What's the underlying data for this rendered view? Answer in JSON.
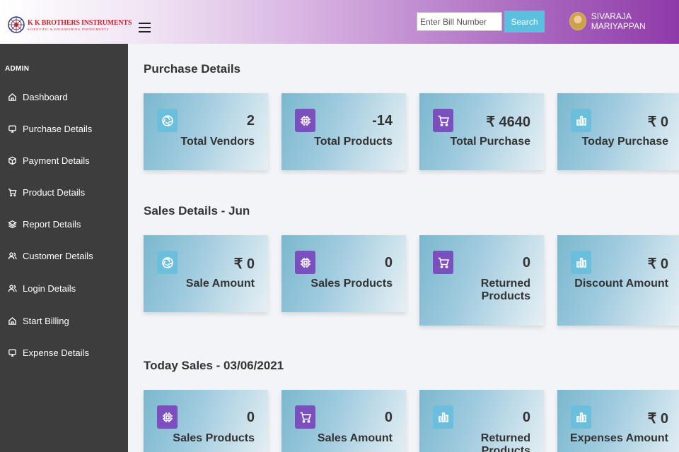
{
  "header": {
    "logo_title": "K K BROTHERS INSTRUMENTS",
    "logo_subtitle": "SCIENTIFIC & ENGINEERING INSTRUMENTS",
    "search_placeholder": "Enter Bill Number",
    "search_label": "Search",
    "user_name": "SIVARAJA MARIYAPPAN"
  },
  "sidebar": {
    "heading": "ADMIN",
    "items": [
      {
        "label": "Dashboard",
        "icon": "home-icon"
      },
      {
        "label": "Purchase Details",
        "icon": "monitor-icon"
      },
      {
        "label": "Payment Details",
        "icon": "box-icon"
      },
      {
        "label": "Product Details",
        "icon": "cart-icon"
      },
      {
        "label": "Report Details",
        "icon": "layers-icon"
      },
      {
        "label": "Customer Details",
        "icon": "users-icon"
      },
      {
        "label": "Login Details",
        "icon": "users-icon"
      },
      {
        "label": "Start Billing",
        "icon": "home-icon"
      },
      {
        "label": "Expense Details",
        "icon": "monitor-icon"
      }
    ]
  },
  "sections": {
    "purchase": {
      "title": "Purchase Details",
      "cards": [
        {
          "value": "2",
          "label": "Total Vendors",
          "icon": "aperture-icon"
        },
        {
          "value": "-14",
          "label": "Total Products",
          "icon": "chip-icon"
        },
        {
          "value": "₹ 4640",
          "label": "Total Purchase",
          "icon": "cart-icon"
        },
        {
          "value": "₹ 0",
          "label": "Today Purchase",
          "icon": "bar-chart-icon"
        }
      ]
    },
    "sales": {
      "title": "Sales Details - Jun",
      "cards": [
        {
          "value": "₹ 0",
          "label": "Sale Amount",
          "icon": "aperture-icon"
        },
        {
          "value": "0",
          "label": "Sales Products",
          "icon": "chip-icon"
        },
        {
          "value": "0",
          "label": "Returned Products",
          "icon": "cart-icon"
        },
        {
          "value": "₹ 0",
          "label": "Discount Amount",
          "icon": "bar-chart-icon"
        }
      ]
    },
    "today": {
      "title": "Today Sales - 03/06/2021",
      "cards": [
        {
          "value": "0",
          "label": "Sales Products",
          "icon": "chip-icon"
        },
        {
          "value": "0",
          "label": "Sales Amount",
          "icon": "cart-icon"
        },
        {
          "value": "0",
          "label": "Returned Products",
          "icon": "bar-chart-icon"
        },
        {
          "value": "₹ 0",
          "label": "Expenses Amount",
          "icon": "bar-chart-icon"
        }
      ]
    }
  },
  "colors": {
    "sidebar_bg": "#3d3d3d",
    "search_button": "#5bc0de",
    "icon_blue": "#6bbfdc",
    "icon_purple": "#7b4fbd"
  }
}
